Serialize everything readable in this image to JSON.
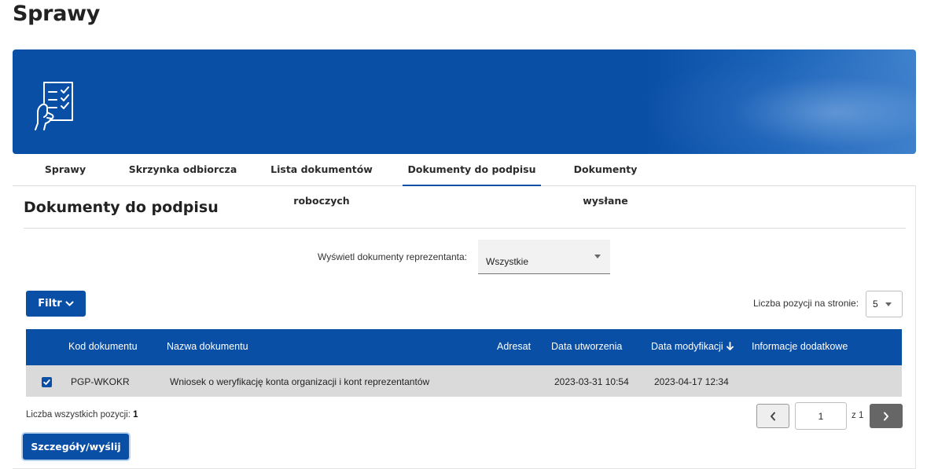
{
  "page": {
    "title": "Sprawy"
  },
  "banner": {
    "icon": "document-checklist-hand-icon"
  },
  "tabs": [
    {
      "label": "Sprawy"
    },
    {
      "label": "Skrzynka odbiorcza"
    },
    {
      "label": "Lista dokumentów roboczych"
    },
    {
      "label": "Dokumenty do podpisu",
      "active": true
    },
    {
      "label": "Dokumenty wysłane"
    }
  ],
  "section": {
    "title": "Dokumenty do podpisu"
  },
  "representative": {
    "label": "Wyświetl dokumenty reprezentanta:",
    "selected": "Wszystkie"
  },
  "filter": {
    "label": "Filtr",
    "icon": "chevron-down-icon"
  },
  "per_page": {
    "label": "Liczba pozycji na stronie:",
    "value": "5"
  },
  "table": {
    "headers": [
      "Kod dokumentu",
      "Nazwa dokumentu",
      "Adresat",
      "Data utworzenia",
      "Data modyfikacji",
      "Informacje dodatkowe"
    ],
    "sort_icon": "arrow-down-icon",
    "rows": [
      {
        "checked": true,
        "code": "PGP-WKOKR",
        "name": "Wniosek o weryfikację konta organizacji i kont reprezentantów",
        "addressee": "",
        "created": "2023-03-31 10:54",
        "modified": "2023-04-17 12:34",
        "info": ""
      }
    ]
  },
  "summary": {
    "label": "Liczba wszystkich pozycji:",
    "count": "1"
  },
  "pagination": {
    "current": "1",
    "of_label": "z 1",
    "prev_icon": "chevron-left-icon",
    "next_icon": "chevron-right-icon"
  },
  "actions": {
    "details_label": "Szczegóły/wyślij"
  },
  "colors": {
    "primary": "#0a4fa6",
    "row_bg": "#dadada",
    "next_btn": "#666666"
  }
}
